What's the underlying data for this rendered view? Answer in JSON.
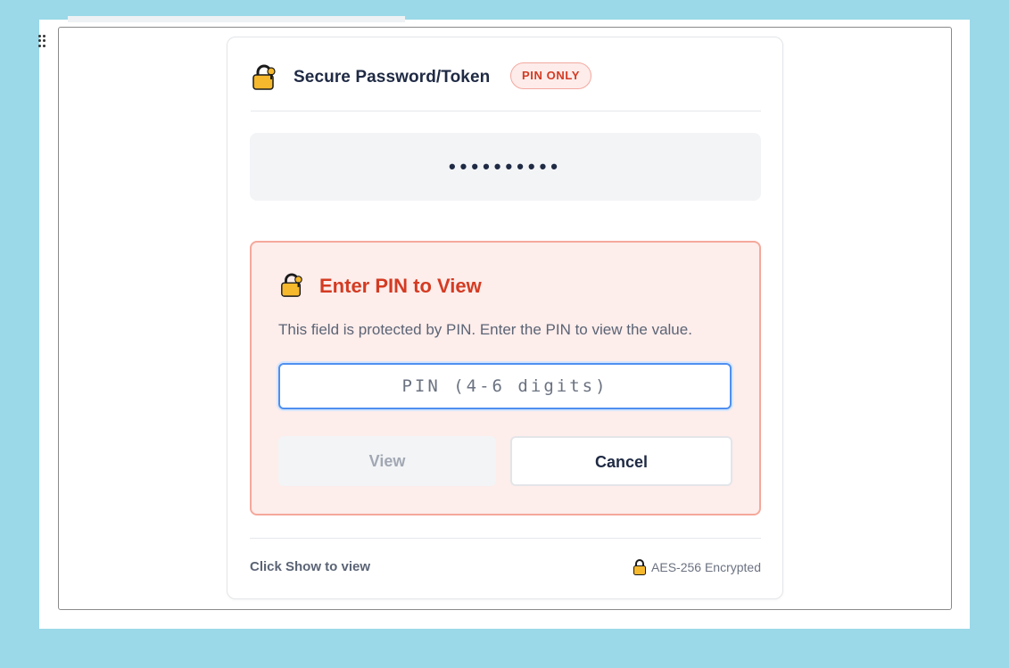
{
  "field": {
    "title": "Secure Password/Token",
    "badge": "PIN ONLY",
    "masked_value": "••••••••••"
  },
  "pin_prompt": {
    "title": "Enter PIN to View",
    "description": "This field is protected by PIN. Enter the PIN to view the value.",
    "input_placeholder": "PIN (4-6 digits)",
    "input_value": "",
    "view_label": "View",
    "cancel_label": "Cancel"
  },
  "footer": {
    "hint": "Click Show to view",
    "encryption": "AES-256 Encrypted"
  },
  "icons": {
    "header_icon": "lock-with-key-icon",
    "prompt_icon": "lock-with-key-icon",
    "footer_icon": "lock-icon",
    "drag_icon": "drag-handle-icon"
  },
  "colors": {
    "accent_red": "#d43b22",
    "input_focus": "#4f8ff0",
    "page_bg": "#9bd9e8"
  }
}
